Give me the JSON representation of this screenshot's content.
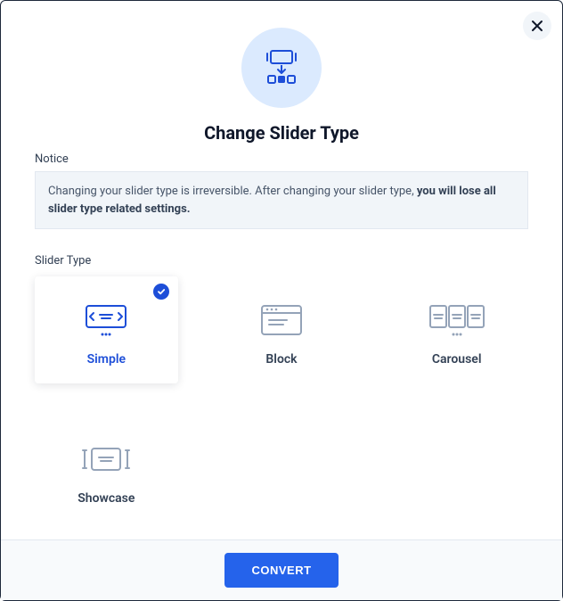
{
  "title": "Change Slider Type",
  "notice_label": "Notice",
  "notice_text": "Changing your slider type is irreversible. After changing your slider type, ",
  "notice_bold": "you will lose all slider type related settings.",
  "slider_type_label": "Slider Type",
  "options": {
    "simple": {
      "label": "Simple",
      "selected": true
    },
    "block": {
      "label": "Block",
      "selected": false
    },
    "carousel": {
      "label": "Carousel",
      "selected": false
    },
    "showcase": {
      "label": "Showcase",
      "selected": false
    }
  },
  "convert_label": "CONVERT",
  "colors": {
    "accent": "#1d4ed8",
    "muted": "#94a3b8"
  }
}
